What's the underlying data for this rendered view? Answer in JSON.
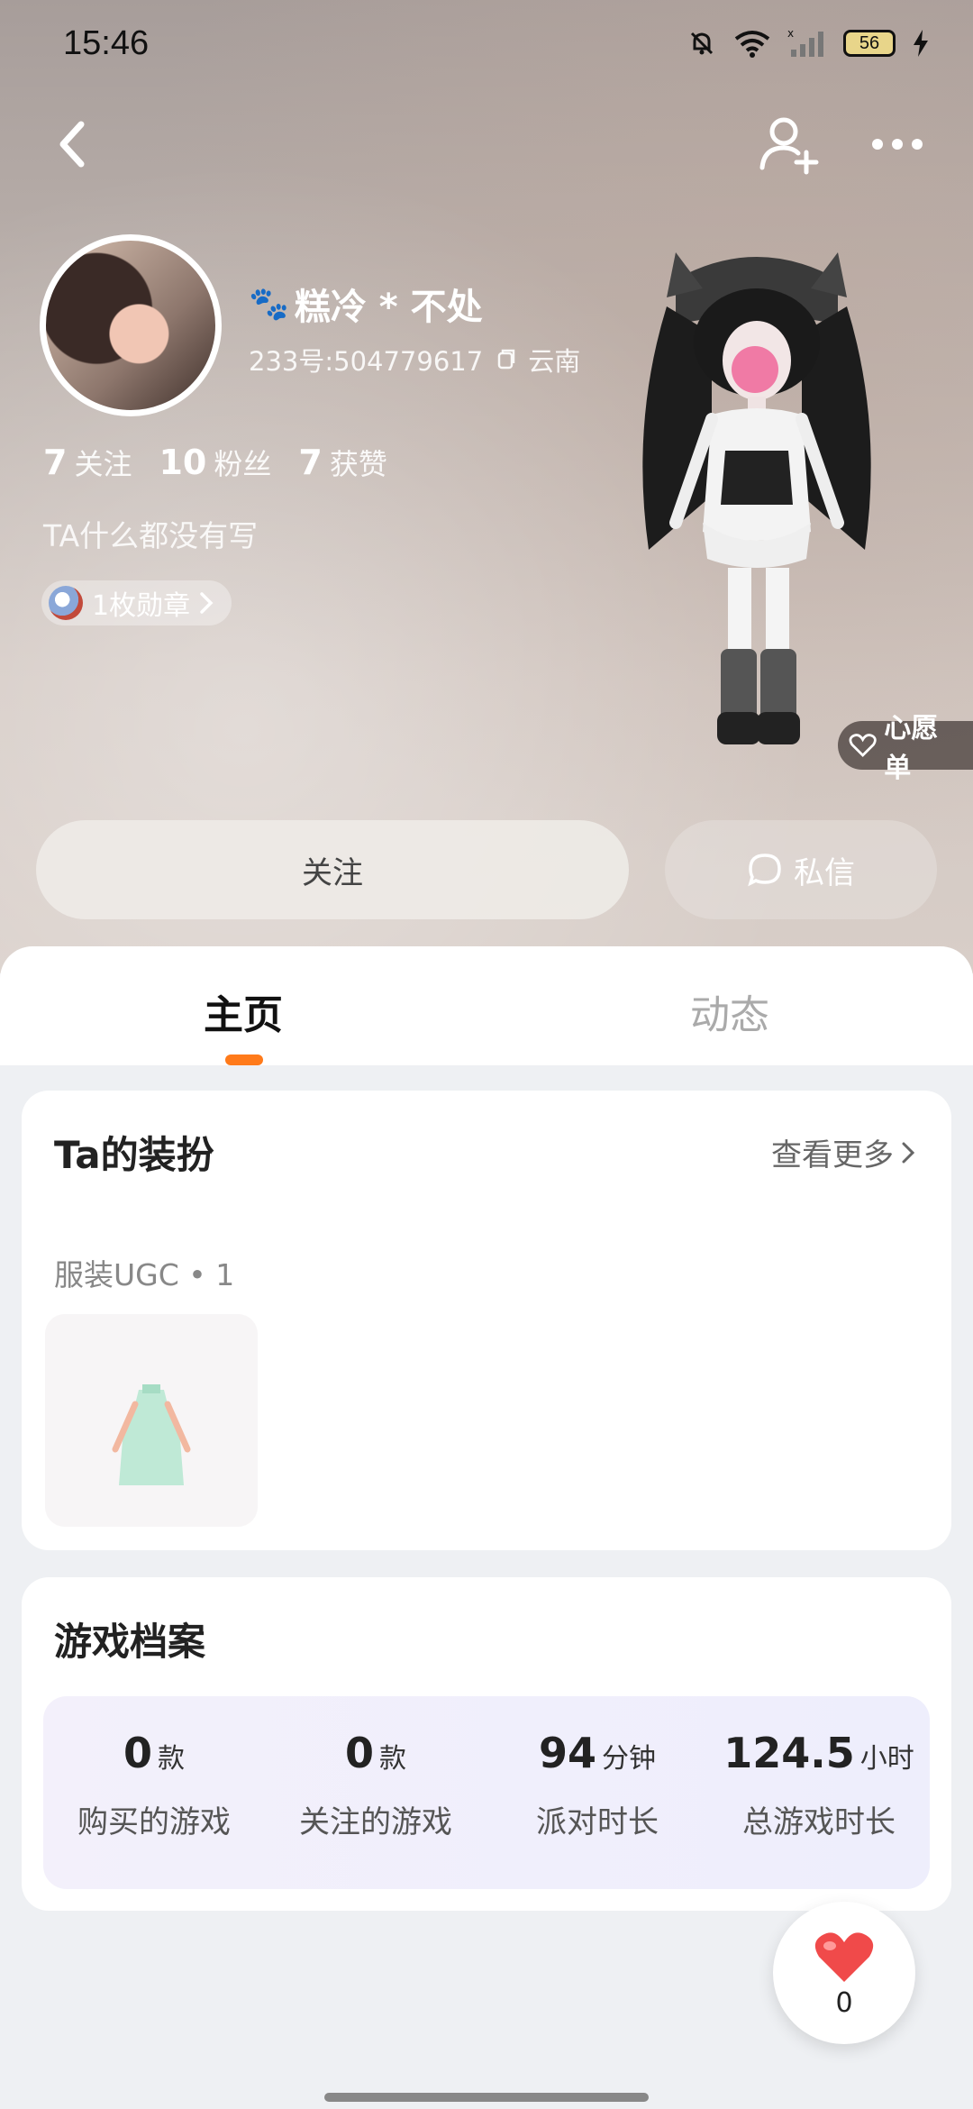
{
  "status_bar": {
    "time": "15:46",
    "battery": "56"
  },
  "profile": {
    "name": "糕冷 * 不处",
    "id_text": "233号:504779617",
    "location": "云南",
    "stats": [
      {
        "value": "7",
        "label": "关注"
      },
      {
        "value": "10",
        "label": "粉丝"
      },
      {
        "value": "7",
        "label": "获赞"
      }
    ],
    "bio": "TA什么都没有写",
    "medal_label": "1枚勋章",
    "wishlist_label": "心愿单"
  },
  "actions": {
    "follow_label": "关注",
    "message_label": "私信"
  },
  "tabs": {
    "home": "主页",
    "feed": "动态"
  },
  "outfit": {
    "title": "Ta的装扮",
    "see_more": "查看更多",
    "subtitle": "服装UGC • 1"
  },
  "archive": {
    "title": "游戏档案",
    "items": [
      {
        "value": "0",
        "unit": "款",
        "label": "购买的游戏"
      },
      {
        "value": "0",
        "unit": "款",
        "label": "关注的游戏"
      },
      {
        "value": "94",
        "unit": "分钟",
        "label": "派对时长"
      },
      {
        "value": "124.5",
        "unit": "小时",
        "label": "总游戏时长"
      }
    ]
  },
  "likes": {
    "count": "0"
  },
  "colors": {
    "accent": "#ff7a1a",
    "heart": "#f04a4a"
  }
}
